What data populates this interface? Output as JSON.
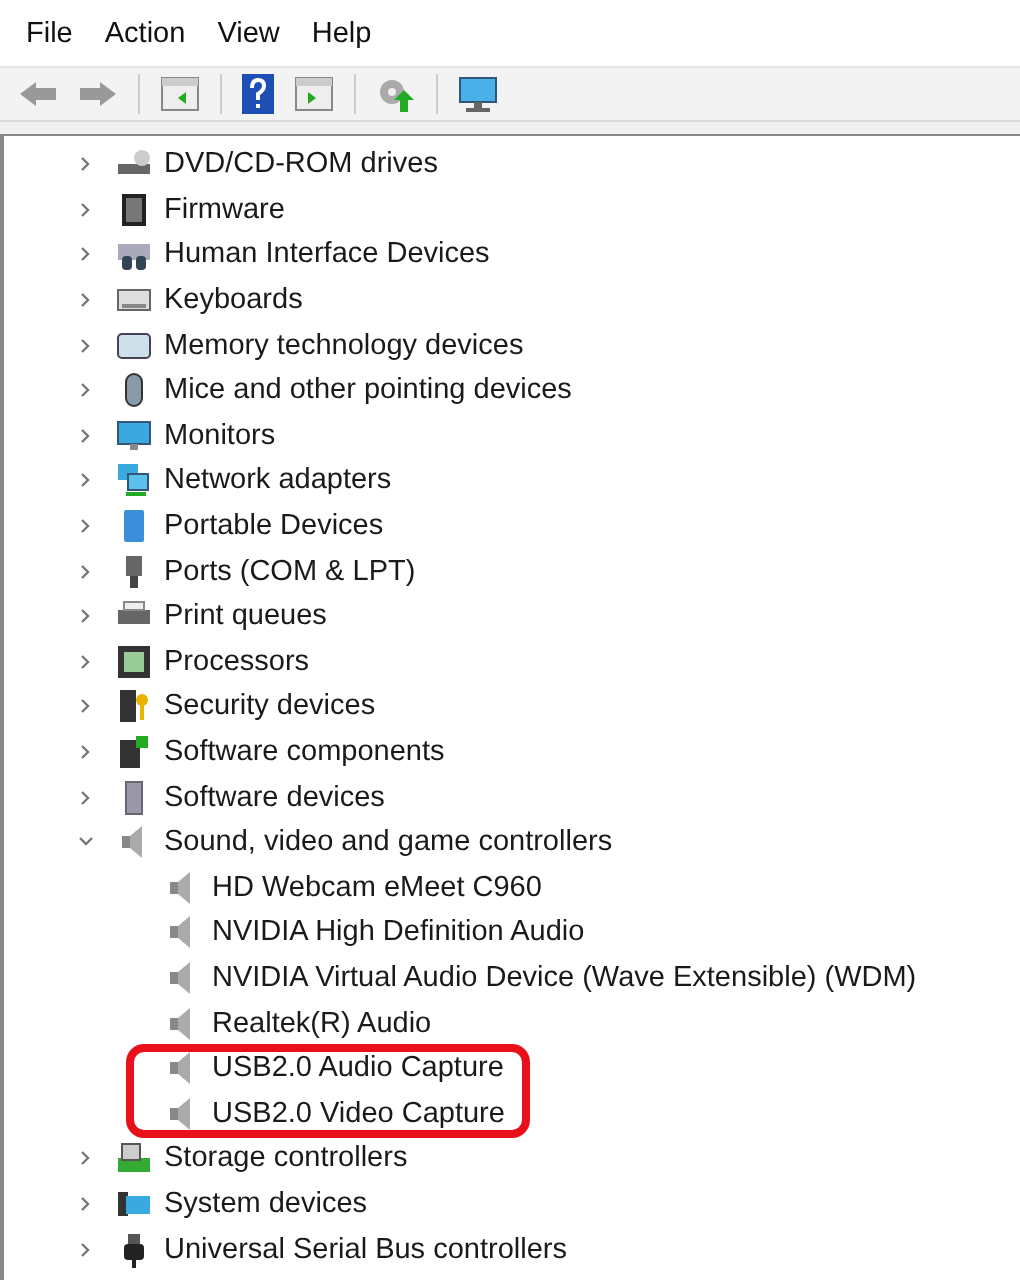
{
  "menu": [
    "File",
    "Action",
    "View",
    "Help"
  ],
  "tree": [
    {
      "label": "DVD/CD-ROM drives",
      "expanded": false
    },
    {
      "label": "Firmware",
      "expanded": false
    },
    {
      "label": "Human Interface Devices",
      "expanded": false
    },
    {
      "label": "Keyboards",
      "expanded": false
    },
    {
      "label": "Memory technology devices",
      "expanded": false
    },
    {
      "label": "Mice and other pointing devices",
      "expanded": false
    },
    {
      "label": "Monitors",
      "expanded": false
    },
    {
      "label": "Network adapters",
      "expanded": false
    },
    {
      "label": "Portable Devices",
      "expanded": false
    },
    {
      "label": "Ports (COM & LPT)",
      "expanded": false
    },
    {
      "label": "Print queues",
      "expanded": false
    },
    {
      "label": "Processors",
      "expanded": false
    },
    {
      "label": "Security devices",
      "expanded": false
    },
    {
      "label": "Software components",
      "expanded": false
    },
    {
      "label": "Software devices",
      "expanded": false
    },
    {
      "label": "Sound, video and game controllers",
      "expanded": true,
      "children": [
        {
          "label": "HD Webcam eMeet C960",
          "highlighted": false
        },
        {
          "label": "NVIDIA High Definition Audio",
          "highlighted": false
        },
        {
          "label": "NVIDIA Virtual Audio Device (Wave Extensible) (WDM)",
          "highlighted": false
        },
        {
          "label": "Realtek(R) Audio",
          "highlighted": false
        },
        {
          "label": "USB2.0 Audio Capture",
          "highlighted": true
        },
        {
          "label": "USB2.0 Video Capture",
          "highlighted": true
        }
      ]
    },
    {
      "label": "Storage controllers",
      "expanded": false
    },
    {
      "label": "System devices",
      "expanded": false
    },
    {
      "label": "Universal Serial Bus controllers",
      "expanded": false
    }
  ]
}
